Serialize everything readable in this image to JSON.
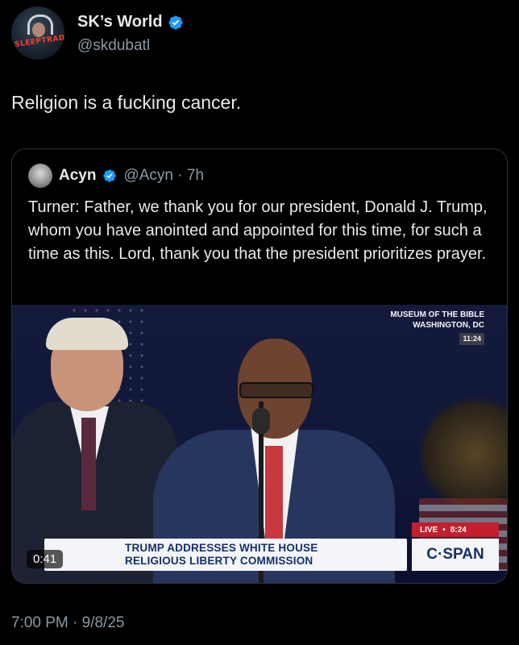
{
  "post": {
    "author_name": "SK’s World",
    "author_handle": "@skdubatl",
    "avatar_text": "SLEEPTRADE",
    "text": "Religion is a fucking cancer.",
    "timestamp": "7:00 PM · 9/8/25"
  },
  "quoted": {
    "author_name": "Acyn",
    "author_handle": "@Acyn · 7h",
    "text": "Turner: Father, we thank you for our president, Donald J. Trump, whom you have anointed and appointed for this time, for such a time as this. Lord, thank you that the president prioritizes prayer.",
    "media": {
      "location_line1": "MUSEUM OF THE BIBLE",
      "location_line2": "WASHINGTON, DC",
      "clock": "11:24",
      "live_label": "LIVE",
      "live_time": "8:24",
      "chyron_line1": "TRUMP ADDRESSES WHITE HOUSE",
      "chyron_line2": "RELIGIOUS LIBERTY COMMISSION",
      "network": "C·SPAN",
      "duration": "0:41"
    }
  },
  "colors": {
    "background": "#000000",
    "text_primary": "#e7e9ea",
    "text_secondary": "#8b98a5",
    "verified_blue": "#1d9bf0",
    "border": "#2f3336"
  },
  "icons": {
    "verified": "verified-badge-icon"
  }
}
